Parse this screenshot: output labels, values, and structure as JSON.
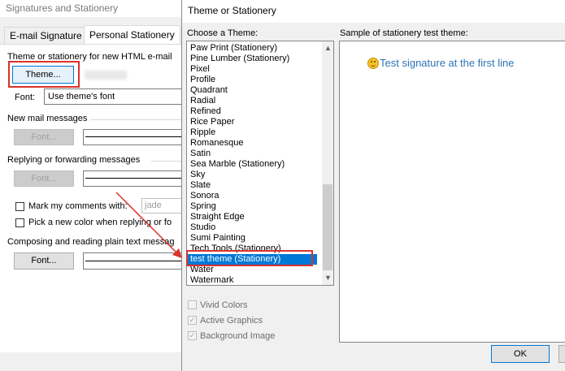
{
  "background_dialog": {
    "title": "Signatures and Stationery",
    "tabs": [
      {
        "label": "E-mail Signature"
      },
      {
        "label": "Personal Stationery"
      }
    ],
    "theme_section_label": "Theme or stationery for new HTML e-mail",
    "theme_button_label": "Theme...",
    "font_label": "Font:",
    "font_value": "Use theme's font",
    "new_mail_label": "New mail messages",
    "replying_label": "Replying or forwarding messages",
    "font_button_label": "Font...",
    "mark_comments_label": "Mark my comments with:",
    "mark_comments_value": "jade",
    "pick_color_label": "Pick a new color when replying or fo",
    "plain_text_label": "Composing and reading plain text messag",
    "ok_label": "OK"
  },
  "theme_dialog": {
    "title": "Theme or Stationery",
    "choose_label": "Choose a Theme:",
    "sample_label": "Sample of stationery test theme:",
    "themes": [
      "Paw Print (Stationery)",
      "Pine Lumber (Stationery)",
      "Pixel",
      "Profile",
      "Quadrant",
      "Radial",
      "Refined",
      "Rice Paper",
      "Ripple",
      "Romanesque",
      "Satin",
      "Sea Marble (Stationery)",
      "Sky",
      "Slate",
      "Sonora",
      "Spring",
      "Straight Edge",
      "Studio",
      "Sumi Painting",
      "Tech Tools (Stationery)",
      "test theme (Stationery)",
      "Water",
      "Watermark"
    ],
    "selected_theme": "test theme (Stationery)",
    "sample_text": "Test signature at the first line",
    "options": [
      {
        "label": "Vivid Colors",
        "checked": false
      },
      {
        "label": "Active Graphics",
        "checked": true
      },
      {
        "label": "Background Image",
        "checked": true
      }
    ],
    "ok_label": "OK"
  },
  "colors": {
    "highlight_red": "#d9332a",
    "selection_blue": "#0078d7",
    "sample_text_blue": "#2e74b5",
    "arrow_red": "#d9332a"
  }
}
